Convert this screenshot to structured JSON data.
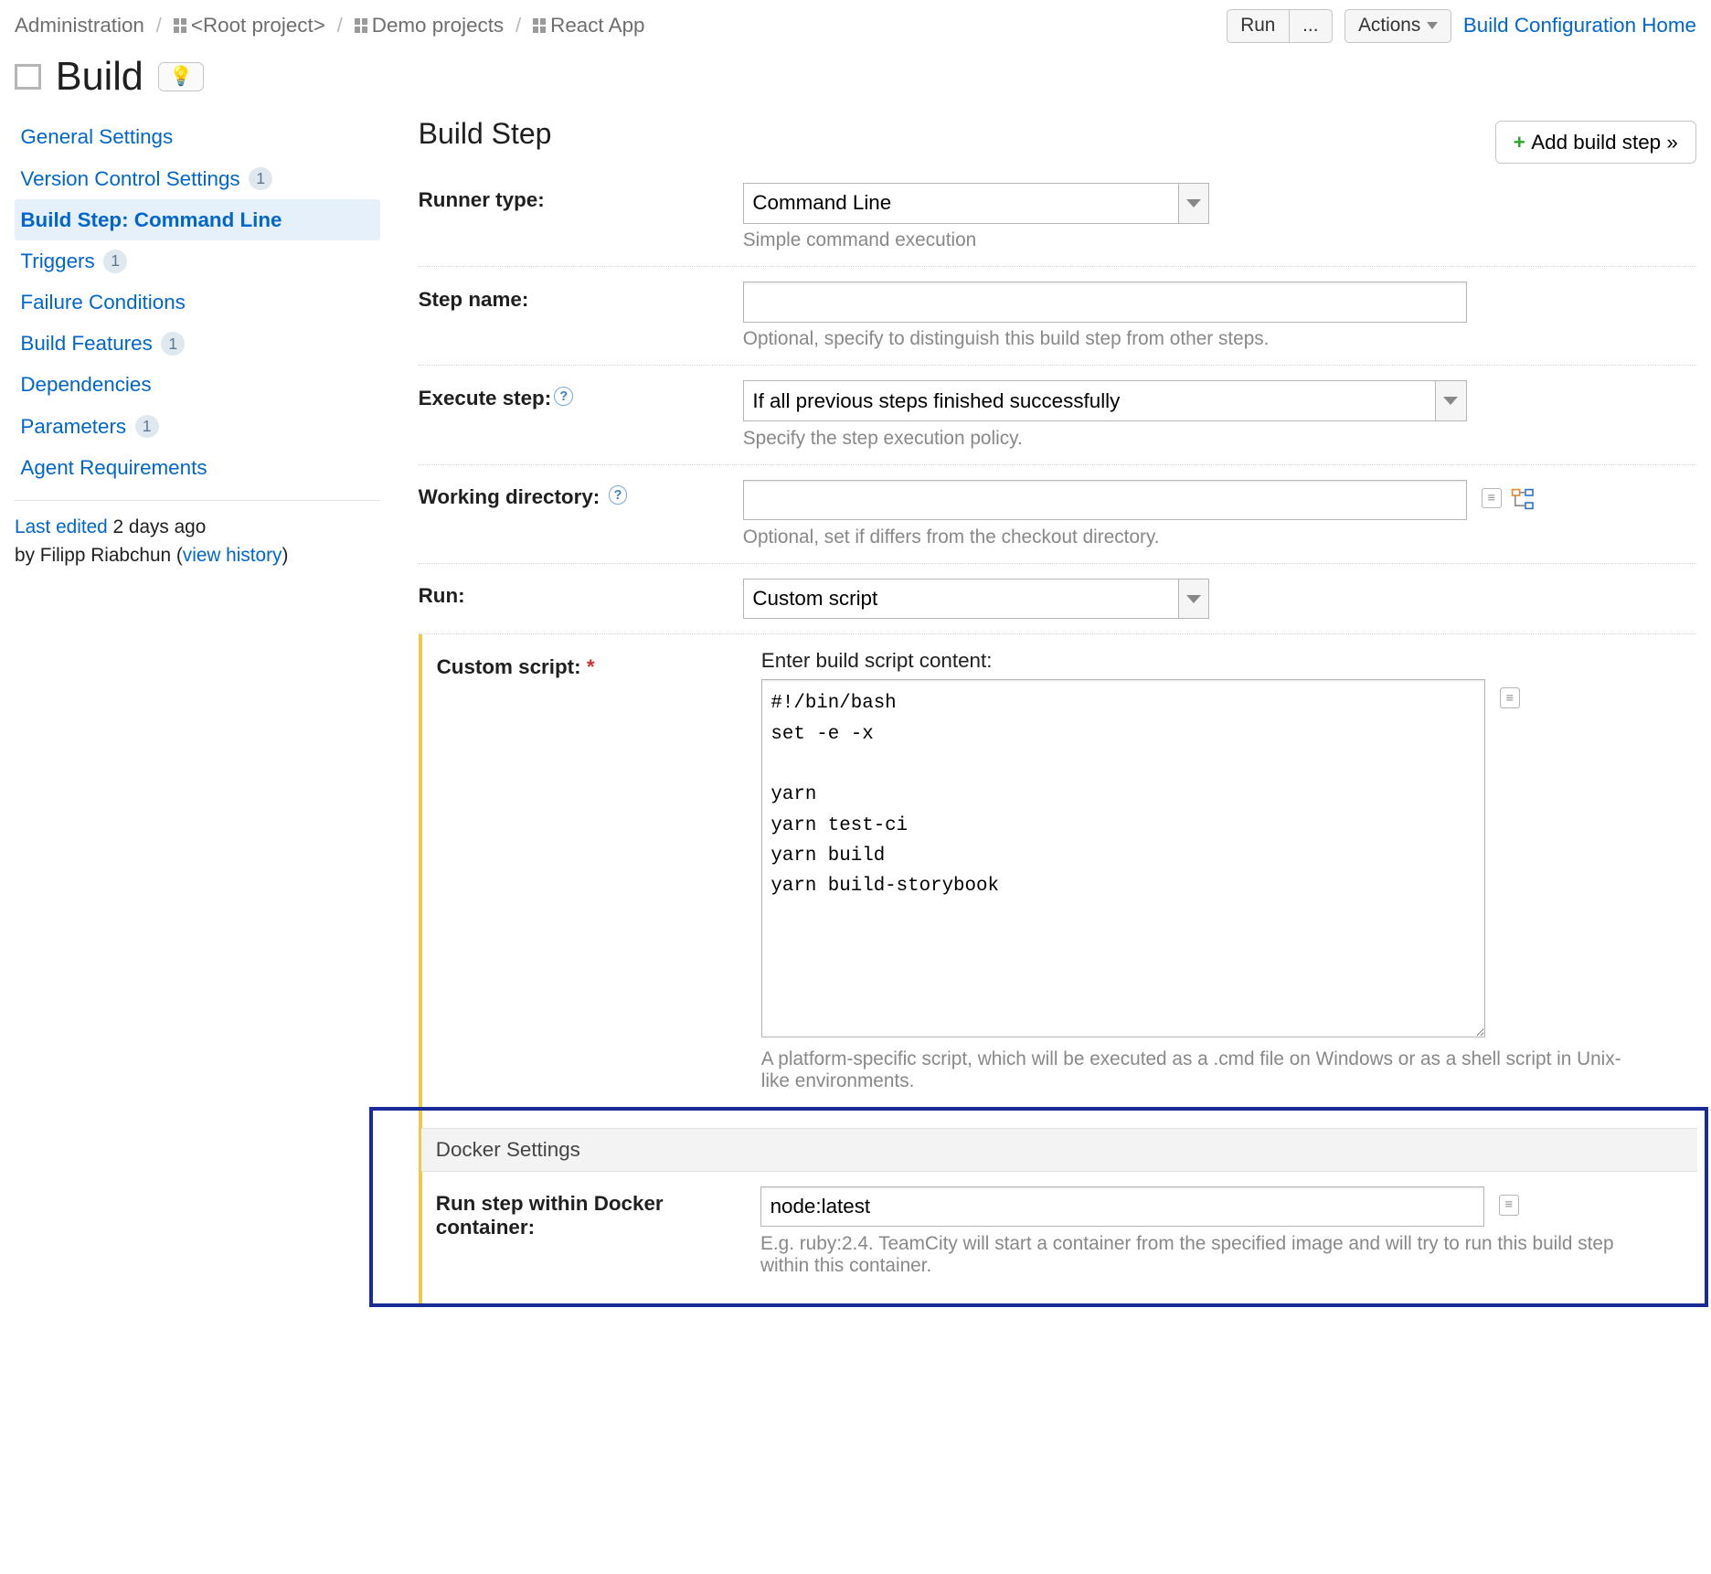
{
  "breadcrumbs": {
    "admin": "Administration",
    "root": "<Root project>",
    "demo": "Demo projects",
    "leaf": "React App"
  },
  "topbar": {
    "run": "Run",
    "more": "...",
    "actions": "Actions",
    "home": "Build Configuration Home"
  },
  "title": "Build",
  "bulb": "💡",
  "sidebar": {
    "items": [
      {
        "label": "General Settings",
        "badge": ""
      },
      {
        "label": "Version Control Settings",
        "badge": "1"
      },
      {
        "label": "Build Step: Command Line",
        "badge": "",
        "active": true
      },
      {
        "label": "Triggers",
        "badge": "1"
      },
      {
        "label": "Failure Conditions",
        "badge": ""
      },
      {
        "label": "Build Features",
        "badge": "1"
      },
      {
        "label": "Dependencies",
        "badge": ""
      },
      {
        "label": "Parameters",
        "badge": "1"
      },
      {
        "label": "Agent Requirements",
        "badge": ""
      }
    ],
    "edited_prefix": "Last edited",
    "edited_when": "2 days ago",
    "edited_by": "by Filipp Riabchun  (",
    "history": "view history",
    "close_paren": ")"
  },
  "main": {
    "heading": "Build Step",
    "add_button": "Add build step »",
    "runner_type": {
      "label": "Runner type:",
      "value": "Command Line",
      "hint": "Simple command execution"
    },
    "step_name": {
      "label": "Step name:",
      "value": "",
      "hint": "Optional, specify to distinguish this build step from other steps."
    },
    "execute": {
      "label": "Execute step:",
      "value": "If all previous steps finished successfully",
      "hint": "Specify the step execution policy."
    },
    "workdir": {
      "label": "Working directory:",
      "value": "",
      "hint": "Optional, set if differs from the checkout directory."
    },
    "run": {
      "label": "Run:",
      "value": "Custom script"
    },
    "script": {
      "label": "Custom script:",
      "prompt": "Enter build script content:",
      "value": "#!/bin/bash\nset -e -x\n\nyarn\nyarn test-ci\nyarn build\nyarn build-storybook",
      "hint": "A platform-specific script, which will be executed as a .cmd file on Windows or as a shell script in Unix-like environments."
    },
    "docker_section": "Docker Settings",
    "docker": {
      "label": "Run step within Docker container:",
      "value": "node:latest",
      "hint": "E.g. ruby:2.4. TeamCity will start a container from the specified image and will try to run this build step within this container."
    }
  }
}
